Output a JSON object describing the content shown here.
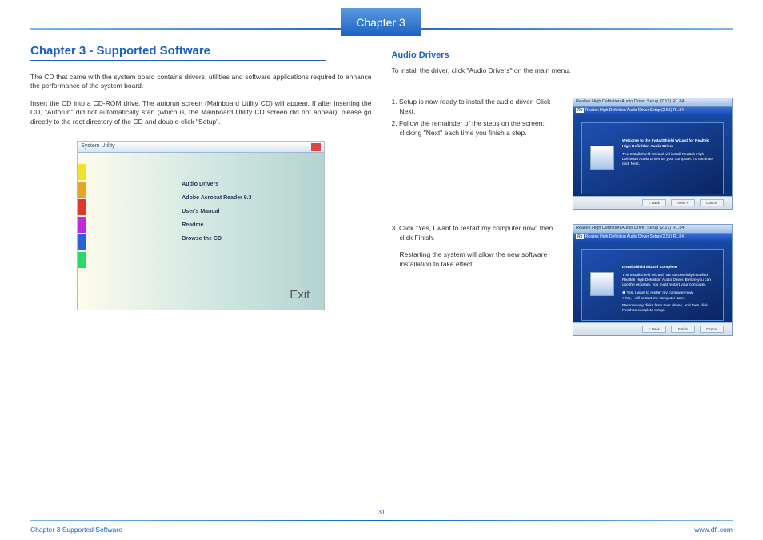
{
  "header": {
    "chapter_tab": "Chapter  3"
  },
  "left": {
    "title": "Chapter 3 - Supported Software",
    "p1": "The CD that came with the system board contains drivers, utilities and software applications required to enhance the performance of the system board.",
    "p2": "Insert the CD into a CD-ROM drive. The autorun screen (Mainboard Utility CD) will appear. If after inserting the CD, \"Autorun\" did not automatically start (which is, the Mainboard Utility CD screen did not appear), please go directly to the root directory of the CD and double-click \"Setup\".",
    "utility": {
      "title": "System Utility",
      "menu": [
        "Audio Drivers",
        "Adobe Acrobat Reader 9.3",
        "User's Manual",
        "Readme",
        "Browse the CD"
      ],
      "exit": "Exit",
      "stripe_colors": [
        "#f2e02a",
        "#e6a52a",
        "#d93a2a",
        "#c22ad9",
        "#2a62d9",
        "#2ad96a"
      ]
    }
  },
  "right": {
    "subtitle": "Audio Drivers",
    "intro": "To install the driver, click \"Audio Drivers\" on the main menu.",
    "step1": "1. Setup is now ready to install the audio driver. Click Next.",
    "step2": "2. Follow the remainder of the steps on the screen; clicking \"Next\" each time you finish a step.",
    "step3a": "3. Click \"Yes, I want to restart my computer now\" then click Finish.",
    "step3b": "Restarting the system will allow the new software installation to take effect.",
    "installer1": {
      "top": "Realtek High Definition Audio Driver Setup (2.51) R1.84",
      "sub": "Realtek High Definition Audio Driver Setup (2.51) R1.84",
      "headline": "Welcome to the InstallShield Wizard for Realtek High Definition Audio Driver",
      "body": "The InstallShield Wizard will install Realtek High Definition Audio Driver on your computer. To continue, click Next.",
      "btns": [
        "< Back",
        "Next >",
        "Cancel"
      ]
    },
    "installer2": {
      "top": "Realtek High Definition Audio Driver Setup (2.51) R1.84",
      "sub": "Realtek High Definition Audio Driver Setup (2.51) R1.84",
      "headline": "InstallShield Wizard Complete",
      "body": "The InstallShield Wizard has successfully installed Realtek High Definition Audio Driver. Before you can use the program, you must restart your computer.",
      "opt1": "Yes, I want to restart my computer now.",
      "opt2": "No, I will restart my computer later.",
      "foot": "Remove any disks from their drives, and then click Finish to complete setup.",
      "btns": [
        "< Back",
        "Finish",
        "Cancel"
      ]
    }
  },
  "page_number": "31",
  "footer": {
    "left": "Chapter 3 Supported Software",
    "right": "www.dfi.com"
  }
}
